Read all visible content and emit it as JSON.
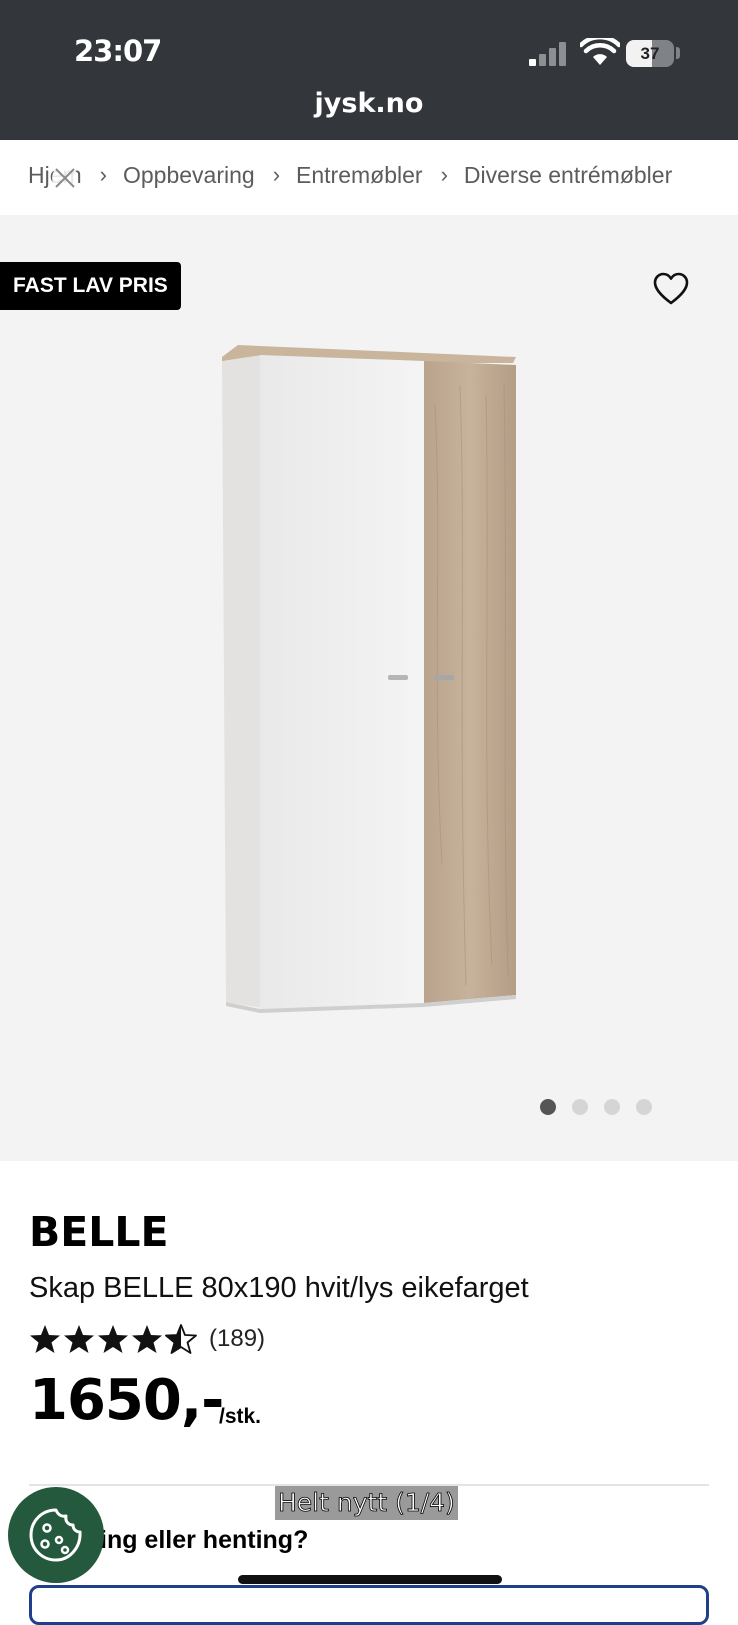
{
  "status_bar": {
    "time": "23:07",
    "battery": "37"
  },
  "browser": {
    "url": "jysk.no"
  },
  "breadcrumb": {
    "items": [
      {
        "label": "Hjem"
      },
      {
        "label": "Oppbevaring"
      },
      {
        "label": "Entremøbler"
      },
      {
        "label": "Diverse entrémøbler"
      }
    ],
    "separator": "›"
  },
  "gallery": {
    "badge": "FAST LAV PRIS",
    "image_count": 4,
    "active_index": 0
  },
  "product": {
    "brand": "BELLE",
    "name": "Skap BELLE 80x190 hvit/lys eikefarget",
    "rating_value": 4.5,
    "rating_max": 5,
    "review_count": "(189)",
    "price": "1650,-",
    "unit": "/stk."
  },
  "overlay": {
    "caption": "Helt nytt (1/4)"
  },
  "delivery": {
    "question_visible": "ing eller henting?"
  },
  "colors": {
    "status_bar_bg": "#33363a",
    "badge_bg": "#000000",
    "cookie_button_bg": "#24593d",
    "gallery_bg": "#f3f3f3",
    "field_border": "#1f3f8a"
  },
  "icons": {
    "wishlist": "heart-outline-icon",
    "cookie": "cookie-icon",
    "signal": "cellular-signal-icon",
    "wifi": "wifi-icon",
    "battery": "battery-icon",
    "star": "star-icon"
  }
}
